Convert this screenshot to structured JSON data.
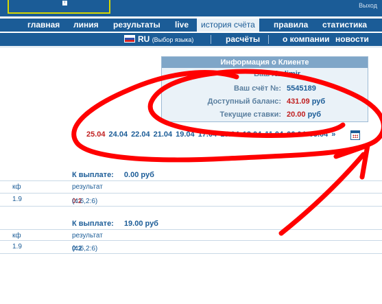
{
  "header": {
    "exit_label": "Выход"
  },
  "nav_main": [
    "главная",
    "линия",
    "результаты",
    "live",
    "история счёта",
    "правила",
    "статистика"
  ],
  "nav_sub": {
    "lang": "RU",
    "lang_hint": "(Выбор языка)",
    "items": [
      "расчёты",
      "о компании",
      "новости"
    ]
  },
  "client_info": {
    "title": "Информация о Клиенте",
    "user_label": "Ваш ло",
    "user_value": "ladimir",
    "account_label": "Ваш счёт №:",
    "account_value": "5545189",
    "balance_label": "Доступный баланс:",
    "balance_value": "431.09",
    "balance_unit": "руб",
    "bets_label": "Текущие ставки:",
    "bets_value": "20.00",
    "bets_unit": "руб"
  },
  "dates": {
    "items": [
      "25.04",
      "24.04",
      "22.04",
      "21.04",
      "19.04",
      "17.04",
      "15.04",
      "12.04",
      "11.04",
      "06.04",
      "05.04"
    ],
    "more": "»"
  },
  "bets": [
    {
      "payout_label": "К выплате:",
      "payout_value": "0.00 руб",
      "col_coef": "кф",
      "col_result": "результат",
      "coef": "1.9",
      "score": "0:2",
      "detail": "(4:6,2:6)"
    },
    {
      "payout_label": "К выплате:",
      "payout_value": "19.00 руб",
      "col_coef": "кф",
      "col_result": "результат",
      "coef": "1.9",
      "score": "0:2",
      "detail": "(4:6,2:6)"
    }
  ],
  "colors": {
    "brand": "#1b5c97",
    "accent_red": "#c02020",
    "scribble": "#ff0000"
  }
}
